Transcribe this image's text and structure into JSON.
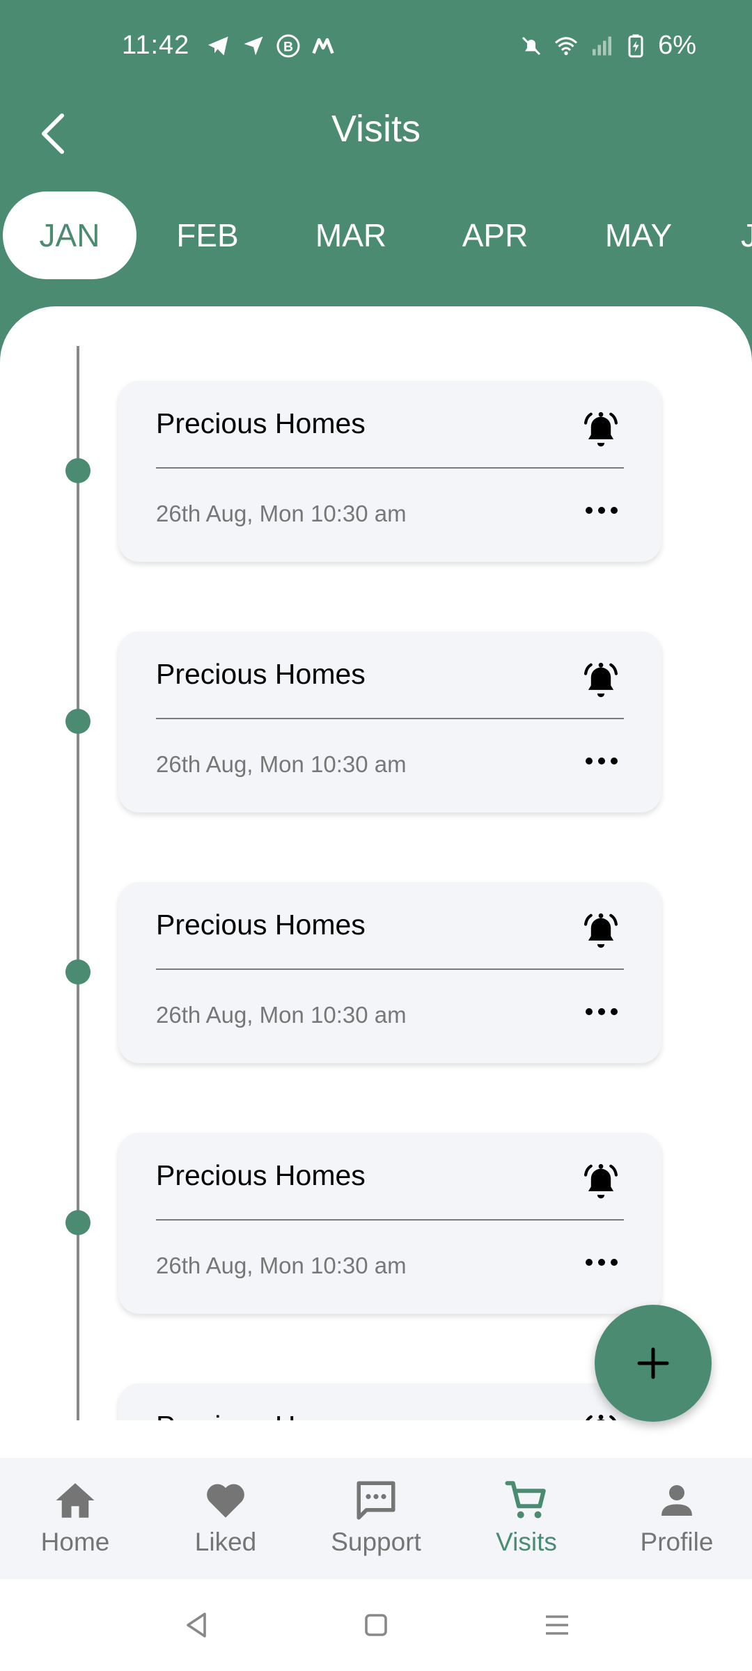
{
  "status_bar": {
    "time": "11:42",
    "battery": "6%",
    "left_icons": [
      "telegram-icon",
      "location-icon",
      "b-icon",
      "m-icon"
    ],
    "right_icons": [
      "mute-bell-icon",
      "wifi-icon",
      "signal-icon",
      "battery-icon"
    ]
  },
  "header": {
    "title": "Visits",
    "back_icon": "chevron-left-icon"
  },
  "months": [
    "JAN",
    "FEB",
    "MAR",
    "APR",
    "MAY",
    "J"
  ],
  "active_month": "JAN",
  "visits": [
    {
      "title": "Precious Homes",
      "date": "26th Aug, Mon 10:30 am"
    },
    {
      "title": "Precious Homes",
      "date": "26th Aug, Mon 10:30 am"
    },
    {
      "title": "Precious Homes",
      "date": "26th Aug, Mon 10:30 am"
    },
    {
      "title": "Precious Homes",
      "date": "26th Aug, Mon 10:30 am"
    },
    {
      "title": "Precious Homes",
      "date": ""
    }
  ],
  "fab_icon": "plus-icon",
  "bottom_nav": [
    {
      "label": "Home",
      "icon": "home-icon"
    },
    {
      "label": "Liked",
      "icon": "heart-icon"
    },
    {
      "label": "Support",
      "icon": "chat-icon"
    },
    {
      "label": "Visits",
      "icon": "cart-icon"
    },
    {
      "label": "Profile",
      "icon": "person-icon"
    }
  ],
  "active_nav": "Visits",
  "colors": {
    "primary": "#4b8b72",
    "card_bg": "#f4f5f8",
    "muted_text": "#777777"
  }
}
